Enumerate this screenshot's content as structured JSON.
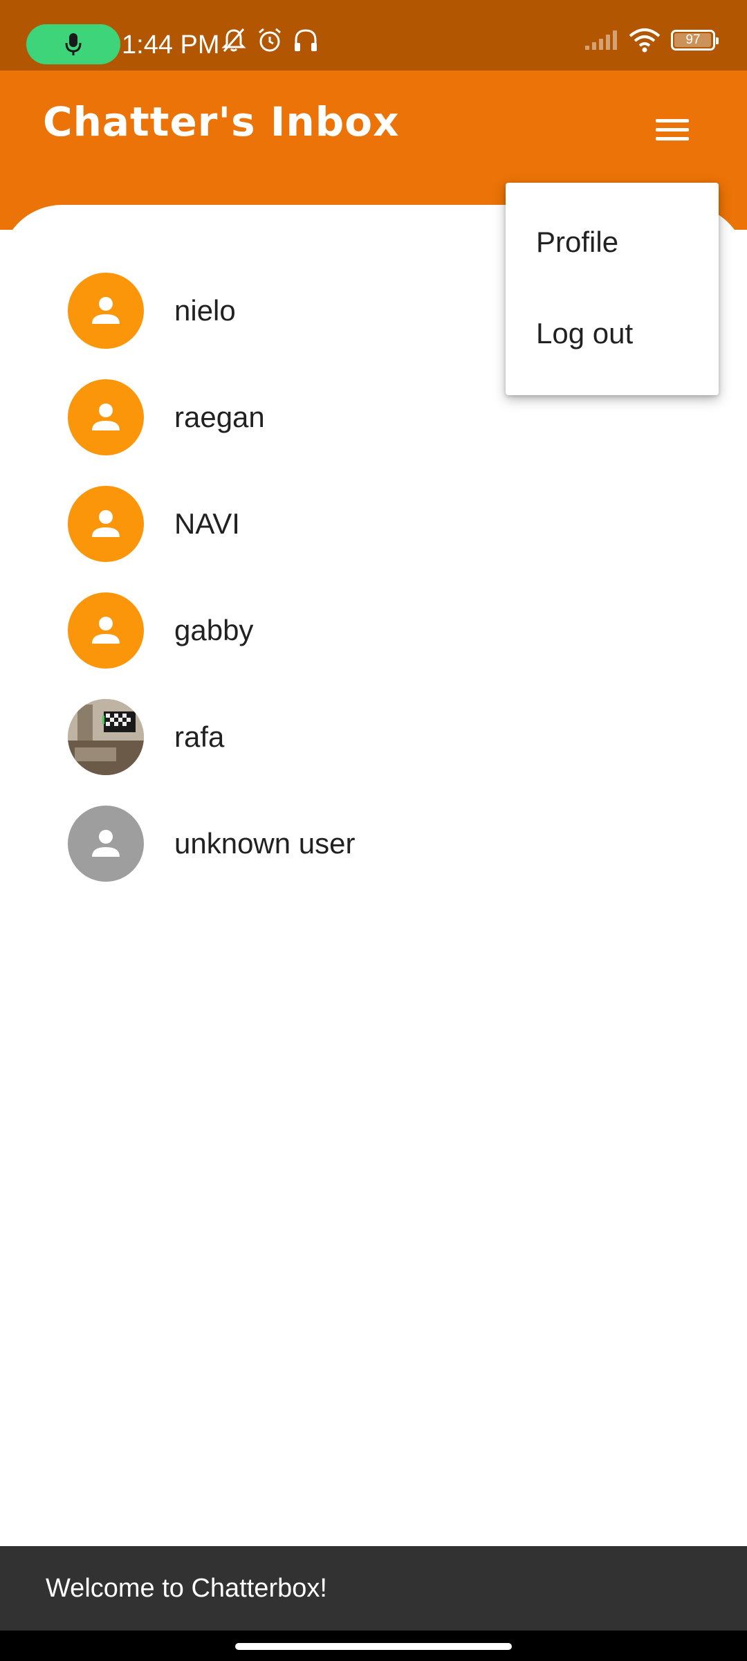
{
  "status_bar": {
    "time": "1:44 PM",
    "battery_level": "97",
    "icons": [
      "mic-icon",
      "bell-off-icon",
      "alarm-icon",
      "headset-icon",
      "signal-icon",
      "wifi-icon",
      "battery-icon"
    ],
    "colors": {
      "background": "#B35602",
      "mic_pill": "#3ED47A"
    }
  },
  "app_bar": {
    "title": "Chatter's Inbox",
    "menu_icon": "hamburger-menu-icon",
    "color": "#EB7307"
  },
  "users": [
    {
      "name": "nielo",
      "avatar": "person-icon",
      "avatar_color": "#FB9509"
    },
    {
      "name": "raegan",
      "avatar": "person-icon",
      "avatar_color": "#FB9509"
    },
    {
      "name": "NAVI",
      "avatar": "person-icon",
      "avatar_color": "#FB9509"
    },
    {
      "name": "gabby",
      "avatar": "person-icon",
      "avatar_color": "#FB9509"
    },
    {
      "name": "rafa",
      "avatar": "photo"
    },
    {
      "name": "unknown user",
      "avatar": "person-icon",
      "avatar_color": "#9E9E9E"
    }
  ],
  "popup_menu": {
    "items": [
      "Profile",
      "Log out"
    ]
  },
  "snackbar": {
    "message": "Welcome to Chatterbox!"
  }
}
